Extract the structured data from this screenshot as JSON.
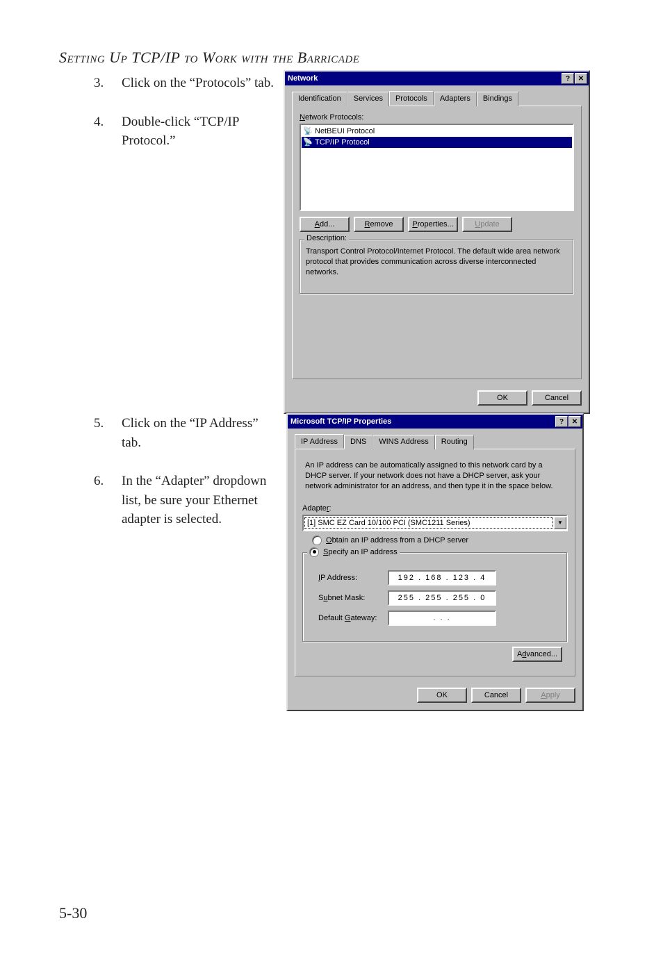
{
  "header": "Setting Up TCP/IP to Work with the Barricade",
  "steps": {
    "s3": {
      "num": "3.",
      "text": "Click on the “Protocols” tab."
    },
    "s4": {
      "num": "4.",
      "text": "Double-click “TCP/IP Protocol.”"
    },
    "s5": {
      "num": "5.",
      "text": "Click on the “IP Address” tab."
    },
    "s6": {
      "num": "6.",
      "text": "In the “Adapter” dropdown list, be sure your Ethernet adapter is selected."
    }
  },
  "pageNumber": "5-30",
  "dialog1": {
    "title": "Network",
    "tabs": {
      "identification": "Identification",
      "services": "Services",
      "protocols": "Protocols",
      "adapters": "Adapters",
      "bindings": "Bindings"
    },
    "listLabelPrefix": "N",
    "listLabelRest": "etwork Protocols:",
    "items": {
      "netbeui": "NetBEUI Protocol",
      "tcpip": "TCP/IP Protocol"
    },
    "buttons": {
      "addPre": "A",
      "addRest": "dd...",
      "removePre": "R",
      "removeRest": "emove",
      "propPre": "P",
      "propRest": "roperties...",
      "updatePre": "U",
      "updateRest": "pdate"
    },
    "descLabel": "Description:",
    "descText": "Transport Control Protocol/Internet Protocol. The default wide area network protocol that provides communication across diverse interconnected networks.",
    "ok": "OK",
    "cancel": "Cancel"
  },
  "dialog2": {
    "title": "Microsoft TCP/IP Properties",
    "tabs": {
      "ip": "IP Address",
      "dns": "DNS",
      "wins": "WINS Address",
      "routing": "Routing"
    },
    "info": "An IP address can be automatically assigned to this network card by a DHCP server.  If your network does not have a DHCP server, ask your network administrator for an address, and then type it in the space below.",
    "adapterPre": "Adapte",
    "adapterU": "r",
    "adapterPost": ":",
    "adapterValue": "[1] SMC EZ Card 10/100 PCI (SMC1211 Series)",
    "radioObtainPre": "O",
    "radioObtainRest": "btain an IP address from a DHCP server",
    "radioSpecifyPre": "S",
    "radioSpecifyRest": "pecify an IP address",
    "fields": {
      "ipPre": "I",
      "ipRest": "P Address:",
      "ipVal": "192 . 168 . 123 .   4",
      "maskPre": "S",
      "maskU": "u",
      "maskRest": "bnet Mask:",
      "maskVal": "255 . 255 . 255 .   0",
      "gwPre": "Default ",
      "gwU": "G",
      "gwRest": "ateway:",
      "gwVal": ".       .       ."
    },
    "advancedPre": "A",
    "advancedU": "d",
    "advancedRest": "vanced...",
    "ok": "OK",
    "cancel": "Cancel",
    "apply": "Apply"
  }
}
